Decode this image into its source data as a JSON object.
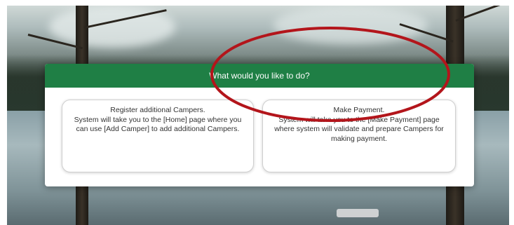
{
  "dialog": {
    "title": "What would you like to do?"
  },
  "options": {
    "register": {
      "text": "Register additional Campers.\nSystem will take you to the [Home] page where you can use [Add Camper] to add additional Campers."
    },
    "payment": {
      "text": "Make Payment.\nSystem will take you to the [Make Payment] page where system will validate and prepare Campers for making payment."
    }
  },
  "colors": {
    "header": "#1f7f45",
    "highlight": "#b3151b"
  }
}
